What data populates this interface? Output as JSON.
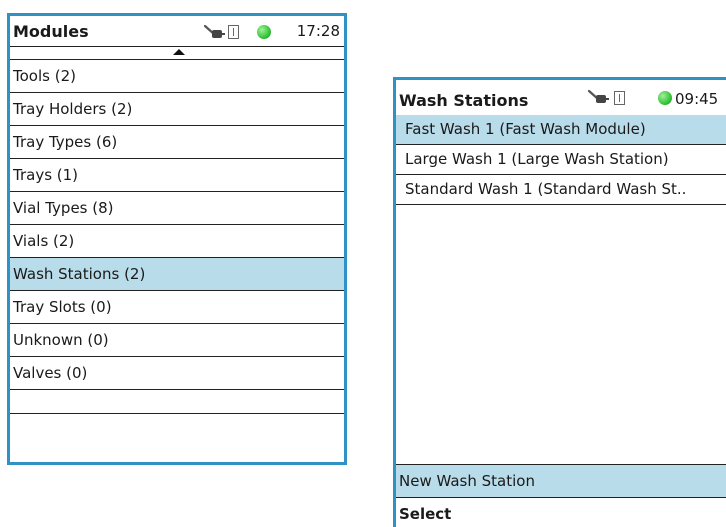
{
  "modules_screen": {
    "title": "Modules",
    "time": "17:28",
    "status_icons": [
      "plug-icon",
      "usb-icon",
      "status-led-icon"
    ],
    "status_led_color": "#2fbf33",
    "items": [
      {
        "label": "Tools (2)"
      },
      {
        "label": "Tray Holders (2)"
      },
      {
        "label": "Tray Types (6)"
      },
      {
        "label": "Trays (1)"
      },
      {
        "label": "Vial Types (8)"
      },
      {
        "label": "Vials (2)"
      },
      {
        "label": "Wash Stations (2)"
      },
      {
        "label": "Tray Slots (0)"
      },
      {
        "label": "Unknown (0)"
      },
      {
        "label": "Valves (0)"
      }
    ],
    "selected_item": "Wash Stations (2)"
  },
  "wash_screen": {
    "title": "Wash Stations",
    "time": "09:45",
    "status_icons": [
      "plug-icon",
      "usb-icon",
      "status-led-icon"
    ],
    "items": [
      {
        "label": "Fast Wash 1 (Fast Wash Module)"
      },
      {
        "label": "Large Wash 1 (Large Wash Station)"
      },
      {
        "label": "Standard Wash 1 (Standard Wash St.."
      }
    ],
    "selected_item": "Fast Wash 1 (Fast Wash Module)",
    "footer": {
      "new_label": "New Wash Station",
      "select_label": "Select"
    }
  },
  "colors": {
    "frame": "#2e93c4",
    "selection": "#b9dcea"
  }
}
